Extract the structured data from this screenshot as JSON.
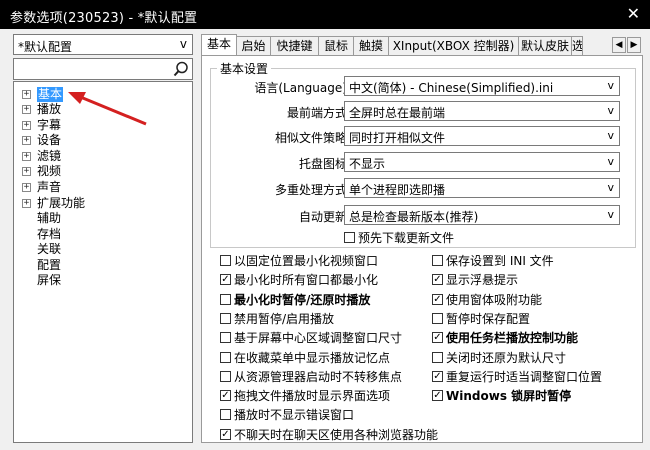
{
  "window": {
    "title": "参数选项(230523) - *默认配置",
    "close_glyph": "✕"
  },
  "preset": {
    "value": "*默认配置",
    "arrow": "v"
  },
  "search": {
    "placeholder": ""
  },
  "tree": [
    {
      "label": "基本",
      "expander": "+",
      "selected": true
    },
    {
      "label": "播放",
      "expander": "+"
    },
    {
      "label": "字幕",
      "expander": "+"
    },
    {
      "label": "设备",
      "expander": "+"
    },
    {
      "label": "滤镜",
      "expander": "+"
    },
    {
      "label": "视频",
      "expander": "+"
    },
    {
      "label": "声音",
      "expander": "+"
    },
    {
      "label": "扩展功能",
      "expander": "+"
    },
    {
      "label": "辅助",
      "expander": ""
    },
    {
      "label": "存档",
      "expander": ""
    },
    {
      "label": "关联",
      "expander": ""
    },
    {
      "label": "配置",
      "expander": ""
    },
    {
      "label": "屏保",
      "expander": ""
    }
  ],
  "tabs": [
    "基本",
    "启始",
    "快捷键",
    "鼠标",
    "触摸",
    "XInput(XBOX 控制器)",
    "默认皮肤",
    "选"
  ],
  "tab_scroll": {
    "left": "◀",
    "right": "▶"
  },
  "group": {
    "title": "基本设置",
    "rows": [
      {
        "label": "语言(Language):",
        "value": "中文(简体) - Chinese(Simplified).ini"
      },
      {
        "label": "最前端方式:",
        "value": "全屏时总在最前端"
      },
      {
        "label": "相似文件策略:",
        "value": "同时打开相似文件"
      },
      {
        "label": "托盘图标:",
        "value": "不显示"
      },
      {
        "label": "多重处理方式:",
        "value": "单个进程即选即播"
      },
      {
        "label": "自动更新:",
        "value": "总是检查最新版本(推荐)"
      }
    ],
    "combo_arrow": "v",
    "predownload": {
      "label": "预先下载更新文件",
      "checked": false
    }
  },
  "checkboxes_left": [
    {
      "label": "以固定位置最小化视频窗口",
      "checked": false,
      "bold": false
    },
    {
      "label": "最小化时所有窗口都最小化",
      "checked": true,
      "bold": false
    },
    {
      "label": "最小化时暂停/还原时播放",
      "checked": false,
      "bold": true
    },
    {
      "label": "禁用暂停/启用播放",
      "checked": false,
      "bold": false
    },
    {
      "label": "基于屏幕中心区域调整窗口尺寸",
      "checked": false,
      "bold": false
    },
    {
      "label": "在收藏菜单中显示播放记忆点",
      "checked": false,
      "bold": false
    },
    {
      "label": "从资源管理器启动时不转移焦点",
      "checked": false,
      "bold": false
    },
    {
      "label": "拖拽文件播放时显示界面选项",
      "checked": true,
      "bold": false
    },
    {
      "label": "播放时不显示错误窗口",
      "checked": false,
      "bold": false
    },
    {
      "label": "不聊天时在聊天区使用各种浏览器功能",
      "checked": true,
      "bold": false
    }
  ],
  "checkboxes_right": [
    {
      "label": "保存设置到 INI 文件",
      "checked": false,
      "bold": false
    },
    {
      "label": "显示浮悬提示",
      "checked": true,
      "bold": false
    },
    {
      "label": "使用窗体吸附功能",
      "checked": true,
      "bold": false
    },
    {
      "label": "暂停时保存配置",
      "checked": false,
      "bold": false
    },
    {
      "label": "使用任务栏播放控制功能",
      "checked": true,
      "bold": true
    },
    {
      "label": "关闭时还原为默认尺寸",
      "checked": false,
      "bold": false
    },
    {
      "label": "重复运行时适当调整窗口位置",
      "checked": true,
      "bold": false
    },
    {
      "label": "Windows 锁屏时暂停",
      "checked": true,
      "bold": true
    }
  ],
  "colors": {
    "selection": "#3399ff",
    "annotation_arrow": "#d42020",
    "titlebar": "#000000"
  }
}
